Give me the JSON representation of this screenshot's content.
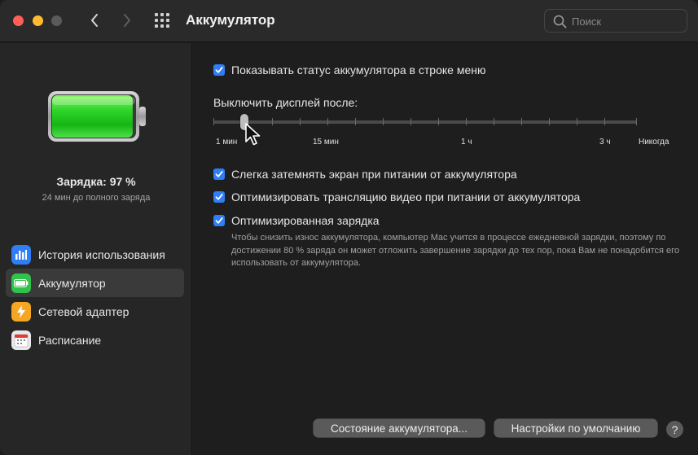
{
  "window": {
    "title": "Аккумулятор"
  },
  "search": {
    "placeholder": "Поиск"
  },
  "sidebar": {
    "charge_status": "Зарядка: 97 %",
    "charge_detail": "24 мин до полного заряда",
    "battery_level_fraction": 0.97,
    "items": [
      {
        "label": "История использования",
        "icon": "usage-history-icon",
        "color": "#2f7ef5",
        "active": false
      },
      {
        "label": "Аккумулятор",
        "icon": "battery-icon",
        "color": "#30c24a",
        "active": true
      },
      {
        "label": "Сетевой адаптер",
        "icon": "power-adapter-icon",
        "color": "#f5a623",
        "active": false
      },
      {
        "label": "Расписание",
        "icon": "calendar-icon",
        "color": "#e9e9e9",
        "active": false
      }
    ]
  },
  "main": {
    "show_status": {
      "label": "Показывать статус аккумулятора в строке меню",
      "checked": true
    },
    "display_off": {
      "label": "Выключить дисплей после:",
      "ticks": [
        "1 мин",
        "15 мин",
        "1 ч",
        "3 ч",
        "Никогда"
      ],
      "value": "2 мин"
    },
    "dim_screen": {
      "label": "Слегка затемнять экран при питании от аккумулятора",
      "checked": true
    },
    "optimize_video": {
      "label": "Оптимизировать трансляцию видео при питании от аккумулятора",
      "checked": true
    },
    "optimized_charging": {
      "label": "Оптимизированная зарядка",
      "checked": true,
      "description": "Чтобы снизить износ аккумулятора, компьютер Mac учится в процессе ежедневной зарядки, поэтому по достижении 80 % заряда он может отложить завершение зарядки до тех пор, пока Вам не понадобится его использовать от аккумулятора."
    },
    "buttons": {
      "battery_health": "Состояние аккумулятора...",
      "restore_defaults": "Настройки по умолчанию",
      "help": "?"
    }
  },
  "colors": {
    "accent": "#2f7ef5",
    "battery_green": "#2ecc2e"
  }
}
